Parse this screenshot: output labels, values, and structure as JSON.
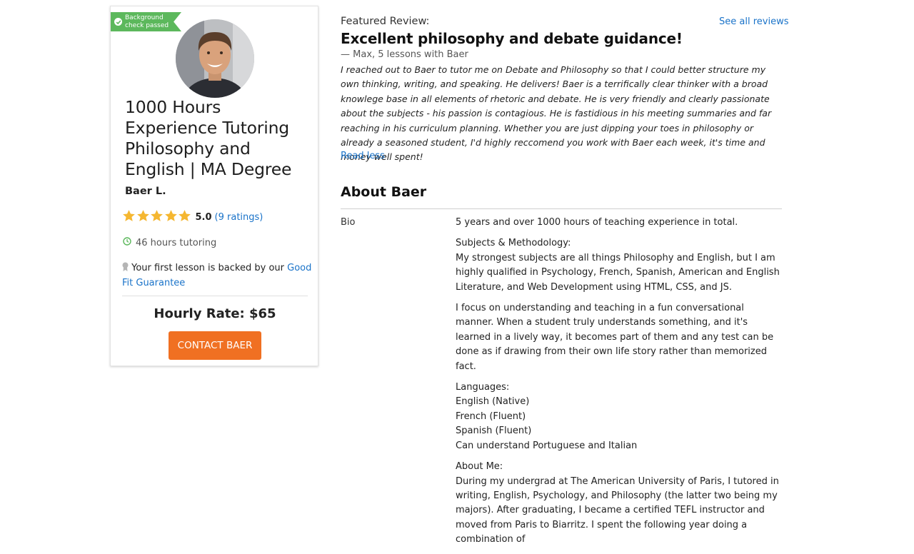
{
  "card": {
    "badge": "Background check passed",
    "headline": "1000 Hours Experience Tutoring Philosophy and English | MA Degree",
    "tutor_name": "Baer L.",
    "rating_value": "5.0",
    "ratings_count": "(9 ratings)",
    "stars": 5,
    "hours": "46 hours tutoring",
    "guarantee_text": "Your first lesson is backed by our",
    "guarantee_link": "Good Fit Guarantee",
    "hourly_rate": "Hourly Rate: $65",
    "contact_button": "CONTACT BAER"
  },
  "review": {
    "label": "Featured Review:",
    "see_all": "See all reviews",
    "title": "Excellent philosophy and debate guidance!",
    "author": "— Max, 5 lessons with Baer",
    "body": "I reached out to Baer to tutor me on Debate and Philosophy so that I could better structure my own thinking, writing, and speaking. He delivers! Baer is a terrifically clear thinker with a broad knowlege base in all elements of rhetoric and debate. He is very friendly and clearly passionate about the subjects - his passion is contagious. He is fastidious in his meeting summaries and far reaching in his curriculum planning. Whether you are just dipping your toes in philosophy or already a seasoned student, I'd highly reccomend you work with Baer each week, it's time and money well spent!",
    "read_less": "Read less"
  },
  "about": {
    "heading": "About Baer",
    "bio_label": "Bio",
    "paragraphs": [
      [
        "5 years and over 1000 hours of teaching experience in total."
      ],
      [
        "Subjects & Methodology:",
        "My strongest subjects are all things Philosophy and English, but I am highly qualified in Psychology, French, Spanish, American and English Literature, and Web Development using HTML, CSS, and JS."
      ],
      [
        "I focus on understanding and teaching in a fun conversational manner. When a student truly understands something, and it's learned in a lively way, it becomes part of them and any test can be done as if drawing from their own life story rather than memorized fact."
      ],
      [
        "Languages:",
        "English (Native)",
        "French (Fluent)",
        "Spanish (Fluent)",
        "Can understand Portuguese and Italian"
      ],
      [
        "About Me:",
        "During my undergrad at The American University of Paris, I tutored in writing, English, Psychology, and Philosophy (the latter two being my majors). After graduating, I became a certified TEFL instructor and moved from Paris to Biarritz. I spent the following year doing a combination of"
      ]
    ]
  },
  "colors": {
    "accent_orange": "#f07022",
    "link_blue": "#1a73c9",
    "badge_green": "#5cb85c",
    "star_gold": "#f5b731"
  },
  "icons": [
    "check-icon",
    "star-icon",
    "clock-icon",
    "ribbon-icon"
  ]
}
